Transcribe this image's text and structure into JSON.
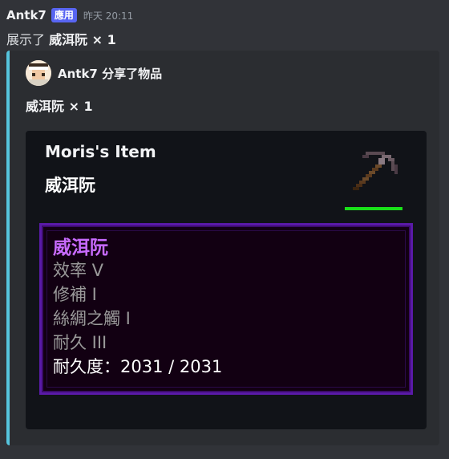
{
  "message": {
    "author": "Antk7",
    "badge": "應用",
    "timestamp": "昨天 20:11",
    "content_prefix": "展示了",
    "content_item": "威洱阮 × 1"
  },
  "embed": {
    "accent_color": "#56c5de",
    "author_name": "Antk7 分享了物品",
    "title": "威洱阮 × 1",
    "card": {
      "owner": "Moris's Item",
      "item_name": "威洱阮",
      "item_icon": "netherite-pickaxe-icon",
      "durability_fraction": 1.0,
      "tooltip": {
        "title": "威洱阮",
        "lines": [
          "效率 V",
          "修補 I",
          "絲綢之觸 I",
          "耐久 III"
        ],
        "durability_text": "耐久度：2031 / 2031"
      }
    }
  }
}
